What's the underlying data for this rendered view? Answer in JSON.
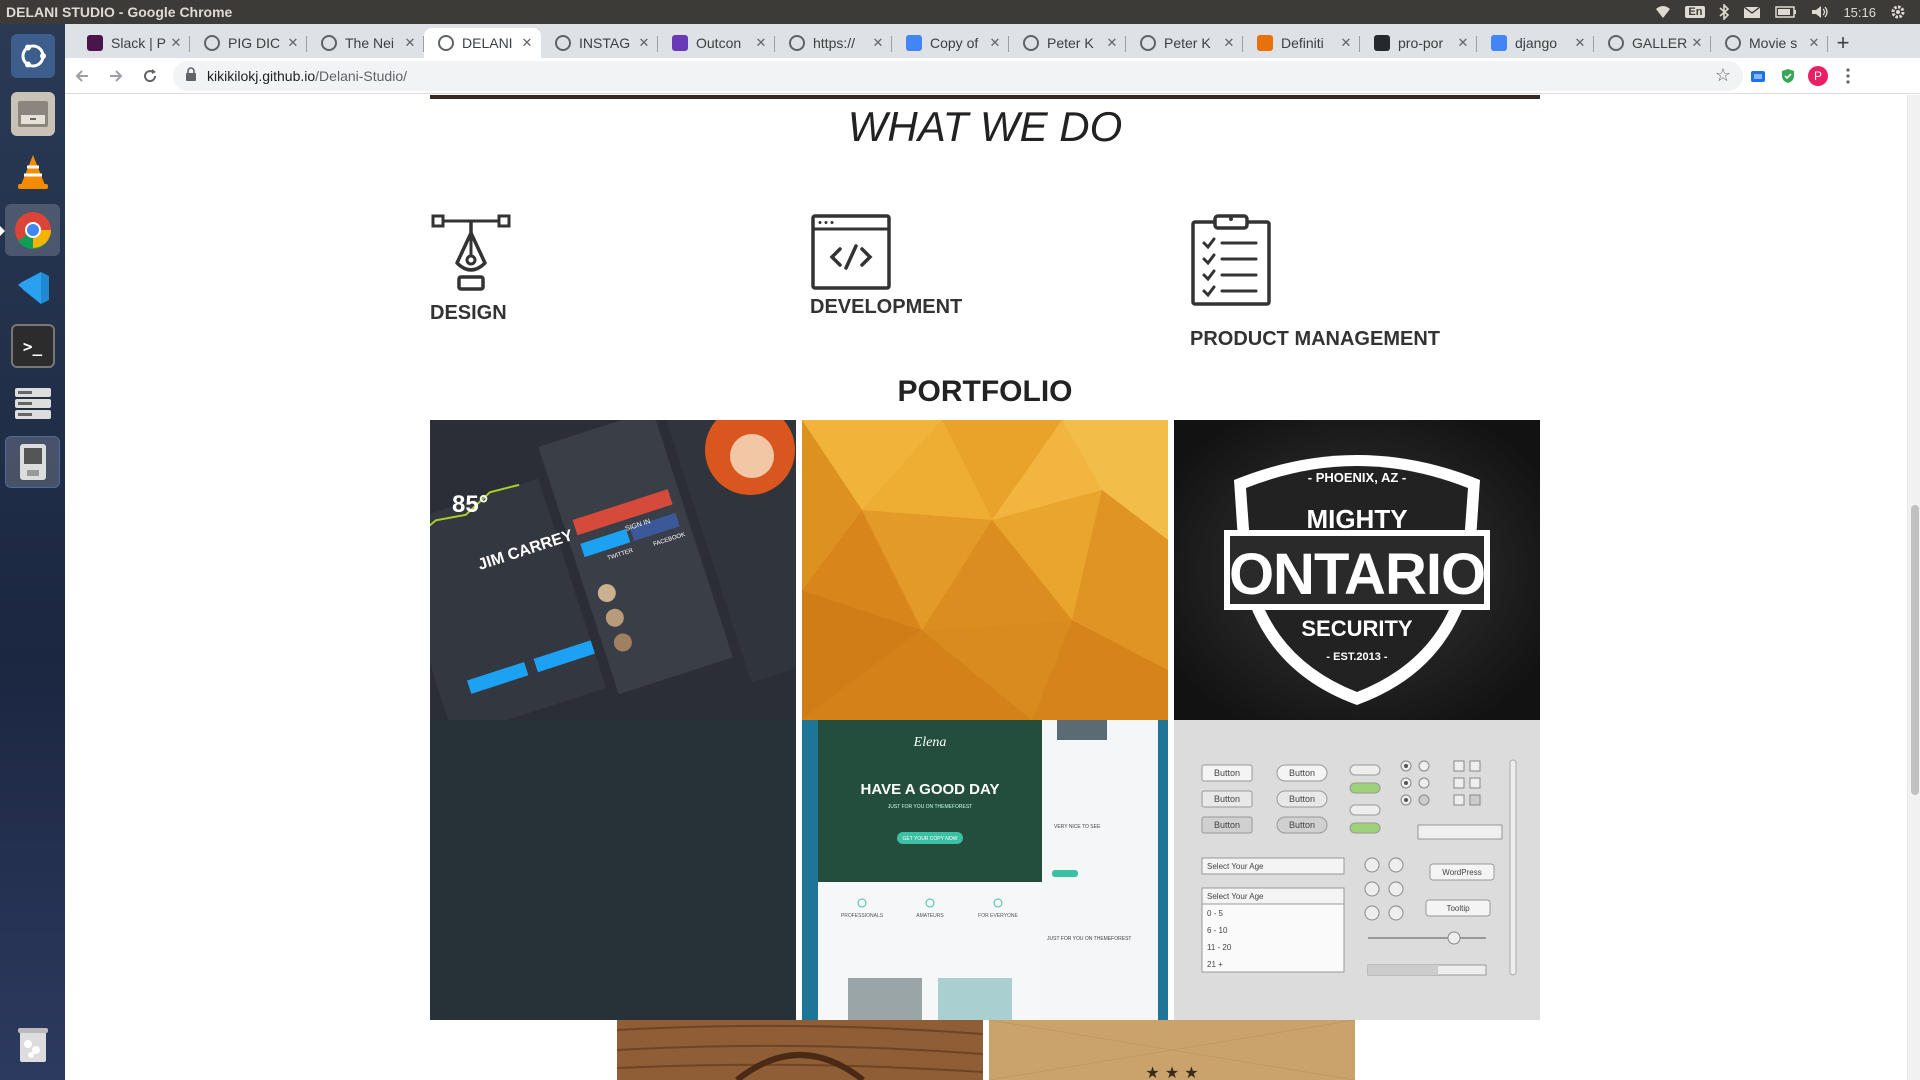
{
  "os": {
    "window_title": "DELANI STUDIO - Google Chrome",
    "keyboard_layout": "En",
    "clock": "15:16"
  },
  "browser": {
    "tabs": [
      {
        "label": "Slack | P",
        "icon": "slack-icon"
      },
      {
        "label": "PIG DIC",
        "icon": "globe-icon"
      },
      {
        "label": "The Nei",
        "icon": "globe-icon"
      },
      {
        "label": "DELANI",
        "icon": "globe-icon",
        "active": true
      },
      {
        "label": "INSTAG",
        "icon": "globe-icon"
      },
      {
        "label": "Outcon",
        "icon": "forms-icon"
      },
      {
        "label": "https://",
        "icon": "globe-icon"
      },
      {
        "label": "Copy of",
        "icon": "docs-icon"
      },
      {
        "label": "Peter K",
        "icon": "globe-icon"
      },
      {
        "label": "Peter K",
        "icon": "globe-icon"
      },
      {
        "label": "Definiti",
        "icon": "codecademy-icon"
      },
      {
        "label": "pro-por",
        "icon": "github-icon"
      },
      {
        "label": "django",
        "icon": "google-icon"
      },
      {
        "label": "GALLER",
        "icon": "globe-icon"
      },
      {
        "label": "Movie s",
        "icon": "globe-icon"
      }
    ],
    "url_host": "kikikilokj.github.io",
    "url_path": "/Delani-Studio/",
    "profile_initial": "P"
  },
  "page": {
    "what_we_do_title": "WHAT WE DO",
    "services": [
      {
        "label": "DESIGN",
        "icon": "pen-tool-icon"
      },
      {
        "label": "DEVELOPMENT",
        "icon": "code-window-icon"
      },
      {
        "label": "PRODUCT MANAGEMENT",
        "icon": "clipboard-checklist-icon"
      }
    ],
    "portfolio_title": "PORTFOLIO",
    "portfolio": {
      "tile1": {
        "weather_temp": "85°",
        "name": "JIM CARREY",
        "sign_in": "SIGN IN",
        "facebook": "FACEBOOK",
        "twitter": "TWITTER"
      },
      "tile3": {
        "top": "- PHOENIX, AZ -",
        "mighty": "MIGHTY",
        "ontario": "ONTARIO",
        "security": "SECURITY",
        "est": "- EST.2013 -"
      },
      "tile5": {
        "brand": "Elena",
        "headline": "HAVE A GOOD DAY",
        "sub": "JUST FOR YOU ON THEMEFOREST",
        "cta": "GET YOUR COPY NOW",
        "col1": "PROFESSIONALS",
        "col2": "AMATEURS",
        "col3": "FOR EVERYONE",
        "side1": "VERY NICE TO SEE",
        "side2": "JUST FOR YOU ON THEMEFOREST"
      },
      "tile6": {
        "button": "Button",
        "select_placeholder": "Select Your Age",
        "options": [
          "0 - 5",
          "6 - 10",
          "11 - 20",
          "21 +"
        ],
        "wordpress": "WordPress",
        "tooltip": "Tooltip"
      }
    }
  },
  "colors": {
    "tile2_orange": "#e7a531",
    "tile4_dark": "#263238",
    "ubuntu_panel": "#3c3b37"
  }
}
